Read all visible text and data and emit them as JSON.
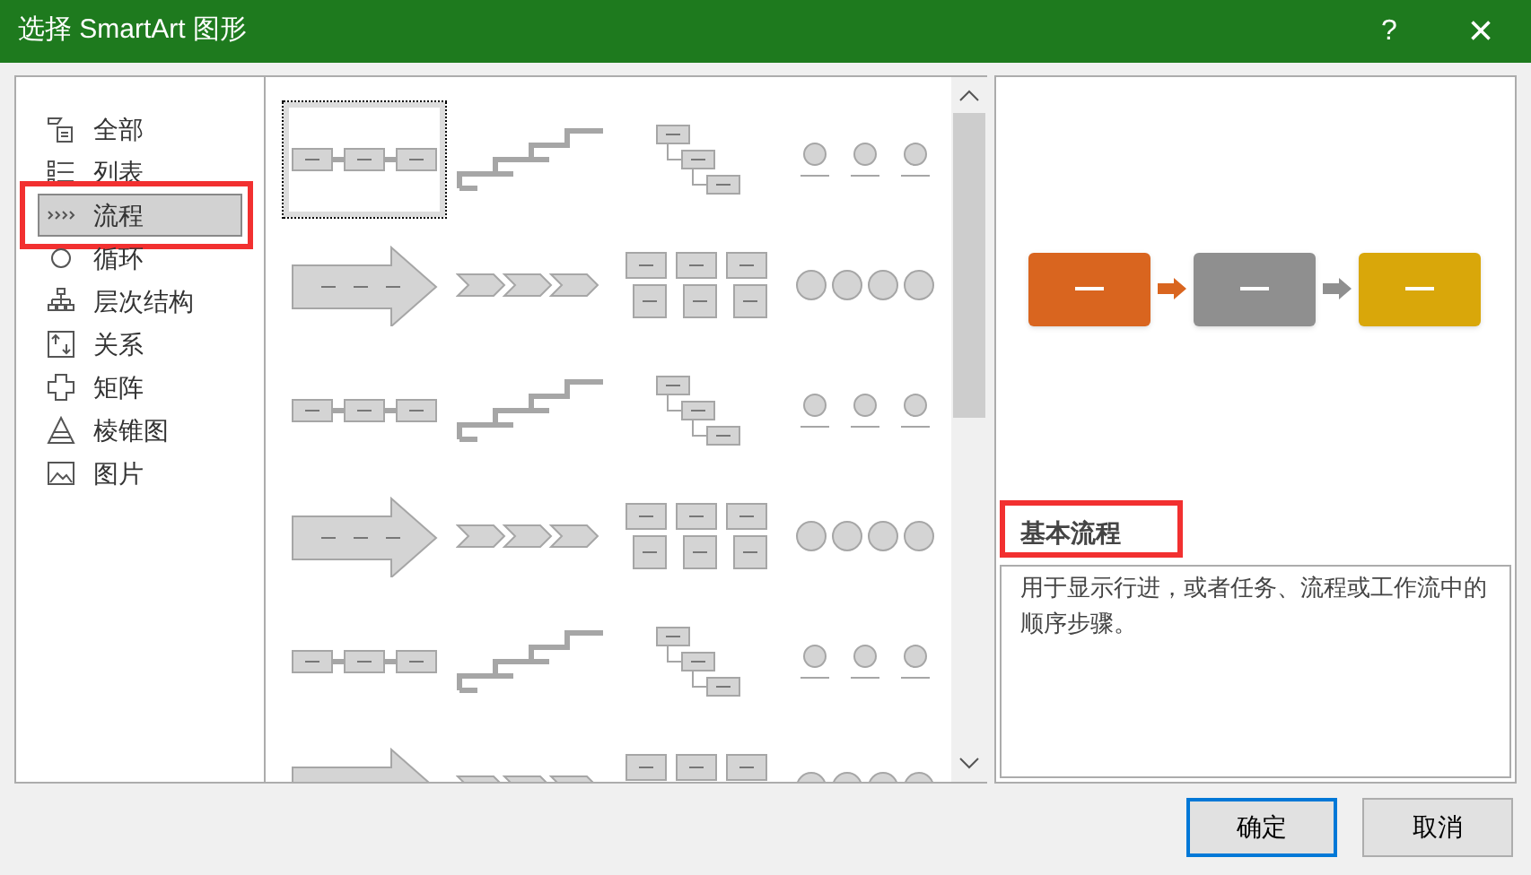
{
  "window": {
    "title": "选择 SmartArt 图形",
    "help": "?",
    "close": "×"
  },
  "categories": [
    {
      "label": "全部",
      "selected": false,
      "kind": "all"
    },
    {
      "label": "列表",
      "selected": false,
      "kind": "list"
    },
    {
      "label": "流程",
      "selected": true,
      "kind": "process"
    },
    {
      "label": "循环",
      "selected": false,
      "kind": "cycle"
    },
    {
      "label": "层次结构",
      "selected": false,
      "kind": "hierarchy"
    },
    {
      "label": "关系",
      "selected": false,
      "kind": "relation"
    },
    {
      "label": "矩阵",
      "selected": false,
      "kind": "matrix"
    },
    {
      "label": "棱锥图",
      "selected": false,
      "kind": "pyramid"
    },
    {
      "label": "图片",
      "selected": false,
      "kind": "picture"
    }
  ],
  "gallery": [
    {
      "selected": true
    },
    {
      "selected": false
    },
    {
      "selected": false
    },
    {
      "selected": false
    },
    {
      "selected": false
    },
    {
      "selected": false
    },
    {
      "selected": false
    },
    {
      "selected": false
    },
    {
      "selected": false
    },
    {
      "selected": false
    },
    {
      "selected": false
    },
    {
      "selected": false
    },
    {
      "selected": false
    },
    {
      "selected": false
    },
    {
      "selected": false
    },
    {
      "selected": false
    },
    {
      "selected": false
    },
    {
      "selected": false
    },
    {
      "selected": false
    },
    {
      "selected": false
    },
    {
      "selected": false
    },
    {
      "selected": false
    },
    {
      "selected": false
    },
    {
      "selected": false
    }
  ],
  "preview": {
    "boxes": [
      {
        "color": "#d9651f"
      },
      {
        "color": "#8f8f8f"
      },
      {
        "color": "#d9a70a"
      }
    ],
    "title": "基本流程",
    "description": "用于显示行进，或者任务、流程或工作流中的顺序步骤。"
  },
  "buttons": [
    {
      "label": "确定",
      "selected": true
    },
    {
      "label": "取消",
      "selected": false
    }
  ]
}
